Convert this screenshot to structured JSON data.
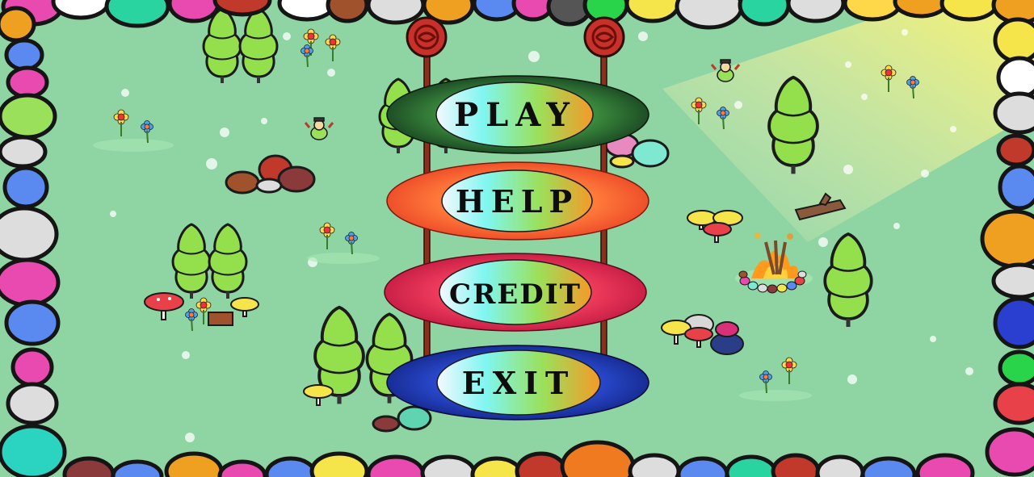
{
  "menu": {
    "play_label": "PLAY",
    "help_label": "HELP",
    "credit_label": "CREDIT",
    "exit_label": "EXIT"
  },
  "colors": {
    "grass": "#8fd4a3",
    "tree": "#94e04c",
    "pole": "#8b2f1f",
    "sign": "#c8302a",
    "play_ring": "#1f4a22",
    "help_ring": "#f04a2a",
    "credit_ring": "#c81c44",
    "exit_ring": "#1a2f9e"
  },
  "icons": [
    "sign-icon",
    "tree-icon",
    "flower-icon",
    "mushroom-icon",
    "rock-icon",
    "campfire-icon",
    "ladybug-icon",
    "log-icon"
  ]
}
